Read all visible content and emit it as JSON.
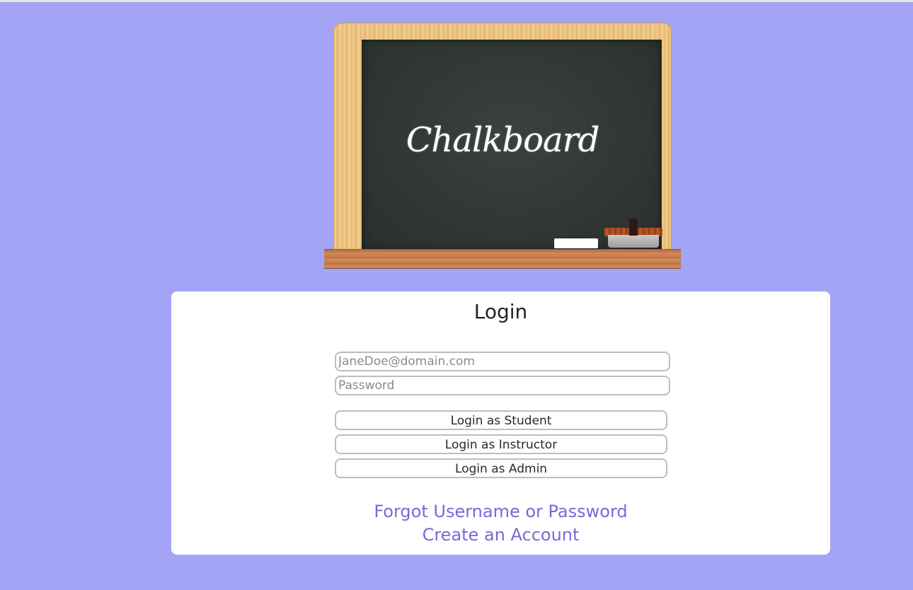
{
  "app": {
    "logo_text": "Chalkboard"
  },
  "login": {
    "title": "Login",
    "email_placeholder": "JaneDoe@domain.com",
    "password_placeholder": "Password",
    "buttons": {
      "student": "Login as Student",
      "instructor": "Login as Instructor",
      "admin": "Login as Admin"
    },
    "links": {
      "forgot": "Forgot Username or Password",
      "create": "Create an Account"
    }
  },
  "colors": {
    "background": "#a3a4f5",
    "link": "#7b68d9",
    "card": "#ffffff"
  }
}
